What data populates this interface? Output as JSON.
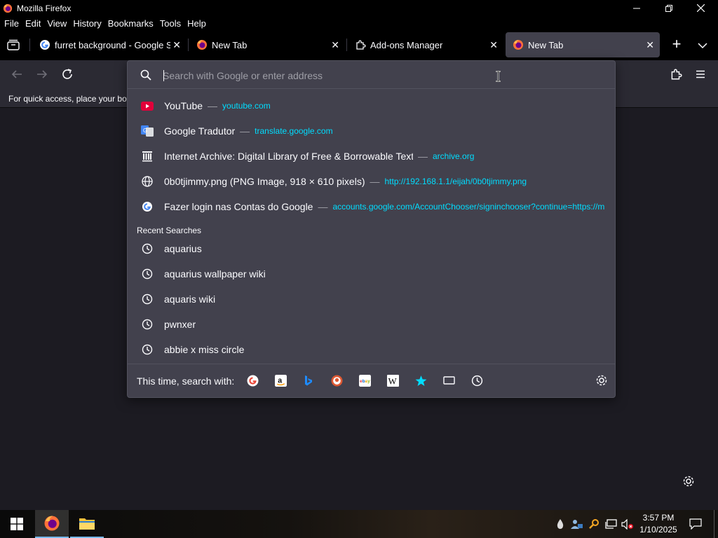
{
  "window": {
    "title": "Mozilla Firefox",
    "minimize": "—",
    "restore": "❐",
    "close": "✕"
  },
  "menu": {
    "file": "File",
    "edit": "Edit",
    "view": "View",
    "history": "History",
    "bookmarks": "Bookmarks",
    "tools": "Tools",
    "help": "Help"
  },
  "tabs": [
    {
      "label": "furret background - Google Sea",
      "icon": "google-icon"
    },
    {
      "label": "New Tab",
      "icon": "firefox-icon"
    },
    {
      "label": "Add-ons Manager",
      "icon": "puzzle-icon"
    },
    {
      "label": "New Tab",
      "icon": "firefox-icon",
      "active": true
    }
  ],
  "tab_close": "✕",
  "new_tab": "+",
  "bookmarks_hint": "For quick access, place your boo",
  "urlbar": {
    "placeholder": "Search with Google or enter address"
  },
  "suggestions": [
    {
      "title": "YouTube",
      "sep": "—",
      "url": "youtube.com",
      "icon": "youtube-icon"
    },
    {
      "title": "Google Tradutor",
      "sep": "—",
      "url": "translate.google.com",
      "icon": "google-translate-icon"
    },
    {
      "title": "Internet Archive: Digital Library of Free & Borrowable Texts",
      "sep": "—",
      "url": "archive.org",
      "icon": "archive-icon"
    },
    {
      "title": "0b0tjimmy.png (PNG Image, 918 × 610 pixels)",
      "sep": "—",
      "url": "http://192.168.1.1/eijah/0b0tjimmy.png",
      "icon": "globe-icon"
    },
    {
      "title": "Fazer login nas Contas do Google",
      "sep": "—",
      "url": "accounts.google.com/AccountChooser/signinchooser?continue=https://m",
      "icon": "google-icon"
    }
  ],
  "recent_header": "Recent Searches",
  "recent": [
    "aquarius",
    "aquarius wallpaper wiki",
    "aquaris wiki",
    "pwnxer",
    "abbie x miss circle"
  ],
  "footer": {
    "label": "This time, search with:",
    "engines": [
      "google-icon",
      "amazon-icon",
      "bing-icon",
      "duckduckgo-icon",
      "ebay-icon",
      "wikipedia-icon",
      "bookmarks-star-icon",
      "tabs-icon",
      "history-icon"
    ]
  },
  "taskbar": {
    "time": "3:57 PM",
    "date": "1/10/2025"
  },
  "colors": {
    "accent": "#00ddff",
    "panel": "#42414d",
    "toolbar": "#2b2a33",
    "page": "#1c1b22"
  }
}
